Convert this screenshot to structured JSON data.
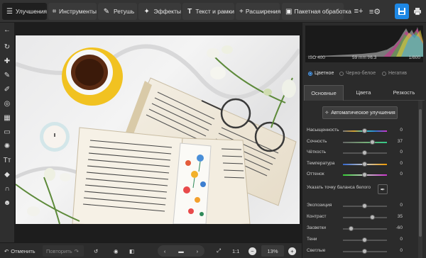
{
  "toolbar": {
    "tabs": [
      {
        "label": "Улучшения",
        "icon": "sliders-icon"
      },
      {
        "label": "Инструменты",
        "icon": "crop-icon"
      },
      {
        "label": "Ретушь",
        "icon": "brush-icon"
      },
      {
        "label": "Эффекты",
        "icon": "sparkle-icon"
      },
      {
        "label": "Текст и рамки",
        "icon": "text-icon"
      },
      {
        "label": "Расширения",
        "icon": "plus-icon"
      },
      {
        "label": "Пакетная обработка",
        "icon": "batch-icon"
      }
    ]
  },
  "histogram": {
    "iso": "ISO 400",
    "lens": "59 mm f/6.3",
    "shutter": "1/800"
  },
  "mode": {
    "options": [
      "Цветное",
      "Черно-белое",
      "Негатив"
    ],
    "selected": "Цветное"
  },
  "panel_tabs": [
    "Основные",
    "Цвета",
    "Резкость"
  ],
  "auto_button": "Автоматическое улучшения",
  "sliders_top": [
    {
      "label": "Насыщенность",
      "value": "0",
      "level": 0.5
    },
    {
      "label": "Сочность",
      "value": "37",
      "level": 0.68
    },
    {
      "label": "Чёткость",
      "value": "0",
      "level": 0.5
    },
    {
      "label": "Температура",
      "value": "0",
      "level": 0.5
    },
    {
      "label": "Оттенок",
      "value": "0",
      "level": 0.5
    }
  ],
  "white_balance_label": "Указать точку баланса белого",
  "sliders_bottom": [
    {
      "label": "Экспозиция",
      "value": "0",
      "level": 0.5
    },
    {
      "label": "Контраст",
      "value": "35",
      "level": 0.67
    },
    {
      "label": "Засветки",
      "value": "-60",
      "level": 0.2
    },
    {
      "label": "Тени",
      "value": "0",
      "level": 0.5
    },
    {
      "label": "Светлые",
      "value": "0",
      "level": 0.5
    }
  ],
  "bottom": {
    "undo": "Отменить",
    "redo": "Повторить",
    "ratio": "1:1",
    "zoom": "13%"
  },
  "colors": {
    "accent": "#1e88e5",
    "active_tab": "#1f1f1f"
  }
}
